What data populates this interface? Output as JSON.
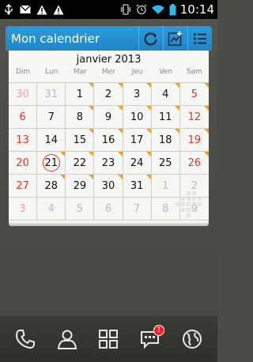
{
  "status_bar": {
    "time": "10:14",
    "icons_left": [
      "usb-icon",
      "mail-icon",
      "warning-icon",
      "warning-icon"
    ],
    "icons_right": [
      "vibrate-icon",
      "alarm-icon",
      "wifi-icon",
      "battery-icon"
    ]
  },
  "widget": {
    "title": "Mon calendrier",
    "buttons": [
      "refresh-icon",
      "add-event-icon",
      "list-icon"
    ],
    "month_title": "janvier 2013",
    "weekdays": [
      "Dim",
      "Lun",
      "Mar",
      "Mer",
      "Jeu",
      "Ven",
      "Sam"
    ],
    "weeks": [
      [
        "30",
        "31",
        "1",
        "2",
        "3",
        "4",
        "5"
      ],
      [
        "6",
        "7",
        "8",
        "9",
        "10",
        "11",
        "12"
      ],
      [
        "13",
        "14",
        "15",
        "16",
        "17",
        "18",
        "19"
      ],
      [
        "20",
        "21",
        "22",
        "23",
        "24",
        "25",
        "26"
      ],
      [
        "27",
        "28",
        "29",
        "30",
        "31",
        "1",
        "2"
      ],
      [
        "3",
        "4",
        "5",
        "6",
        "7",
        "8",
        "9"
      ]
    ],
    "today": "21"
  },
  "dock": {
    "items": [
      "phone-icon",
      "contacts-icon",
      "apps-grid-icon",
      "messages-icon",
      "browser-icon"
    ],
    "messages_badge": "1"
  },
  "colors": {
    "header_blue": "#1f86c8",
    "sunday_red": "#e03030",
    "event_marker": "#f0a020"
  }
}
